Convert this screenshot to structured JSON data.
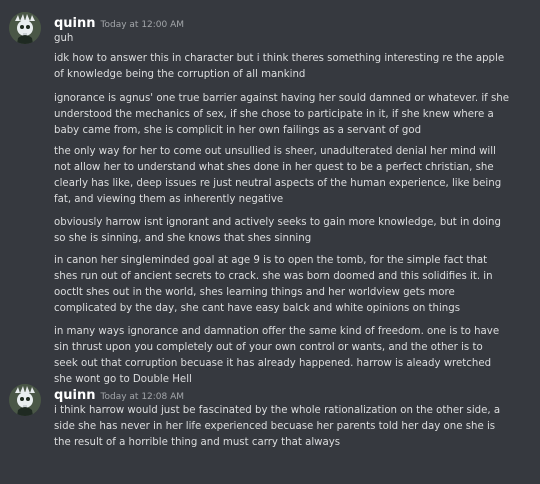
{
  "messages": [
    {
      "username": "quinn",
      "timestamp": "Today at 12:00 AM",
      "paragraphs": [
        [
          "guh"
        ],
        [
          "idk how to answer this in character but i think theres something interesting re the apple",
          "of knowledge being the corruption of all mankind"
        ],
        [
          "ignorance is agnus' one true barrier against having her sould damned or whatever. if she",
          "understood the mechanics of sex, if she chose to participate in it, if she knew where a",
          "baby came from, she is complicit in her own failings as a servant of god"
        ],
        [
          "the only way for her to come out unsullied is sheer, unadulterated denial her mind will",
          "not allow her to understand what shes done in her quest to be a perfect christian, she",
          "clearly has like, deep issues re just neutral aspects of the human experience, like being",
          "fat, and viewing them as inherently negative"
        ],
        [
          "obviously harrow isnt ignorant and actively seeks to gain more knowledge, but in doing",
          "so she is sinning, and she knows that shes sinning"
        ],
        [
          "in canon her singleminded goal at age 9 is to open the tomb, for the simple fact that",
          "shes run out of ancient secrets to crack. she was born doomed and this solidifies it. in",
          "ooctlt shes out in the world, shes learning things and her worldview gets more",
          "complicated by the day, she cant have easy balck and white opinions on things"
        ],
        [
          "in many ways ignorance and damnation offer the same kind of freedom. one is to have",
          "sin thrust upon you completely out of your own control or wants, and the other is to",
          "seek out that corruption becuase it has already happened. harrow is aleady wretched",
          "she wont go to Double Hell"
        ]
      ]
    },
    {
      "username": "quinn",
      "timestamp": "Today at 12:08 AM",
      "paragraphs": [
        [
          "i think harrow would just be fascinated by the whole rationalization on the other side, a",
          "side she has never in her life experienced becuase her parents told her day one she is",
          "the result of a horrible thing and must carry that always"
        ]
      ]
    }
  ],
  "colors": {
    "background": "#36393f",
    "text": "#dcddde",
    "username": "#ffffff",
    "timestamp": "#a3a6aa"
  },
  "avatar_icon": "skull-headdress-avatar"
}
